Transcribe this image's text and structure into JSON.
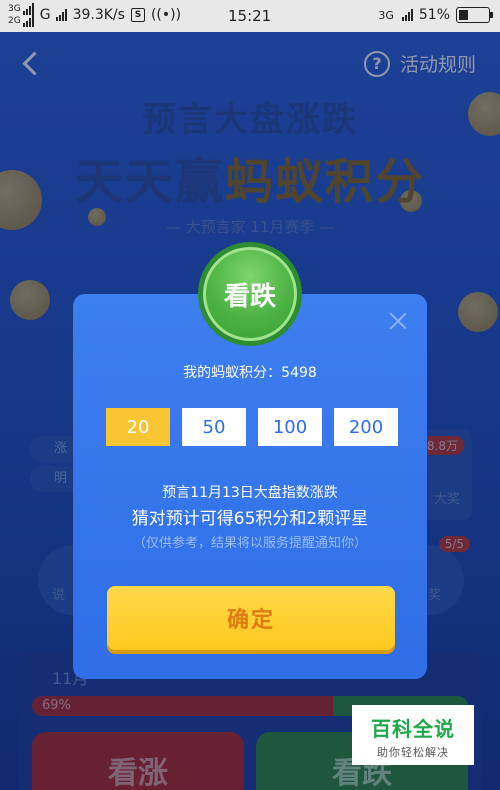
{
  "status_bar": {
    "net_top": "3G",
    "net_bottom": "2G",
    "carrier": "G",
    "speed": "39.3K/s",
    "time": "15:21",
    "net_right": "3G",
    "battery": "51%"
  },
  "navbar": {
    "rules_label": "活动规则"
  },
  "hero": {
    "line1": "预言大盘涨跌",
    "line2_prefix": "天天赢",
    "line2_highlight": "蚂蚁积分",
    "season": "— 大预言家 11月赛季 —"
  },
  "background": {
    "pill1": "涨",
    "pill2": "明",
    "right_badge": "38.8万",
    "right_text": "大奖",
    "badge_count": "5/5",
    "circle_left": "说",
    "circle_right": "奖",
    "bottom_left_text": "11月",
    "progress_percent": 69,
    "progress_label": "69%",
    "btn_rise": "看涨",
    "btn_fall": "看跌"
  },
  "modal": {
    "badge": "看跌",
    "points_text": "我的蚂蚁积分：5498",
    "options": [
      "20",
      "50",
      "100",
      "200"
    ],
    "selected_option": "20",
    "prediction_line1": "预言11月13日大盘指数涨跌",
    "prediction_line2": "猜对预计可得65积分和2颗评星",
    "prediction_note": "（仅供参考，结果将以服务提醒通知你）",
    "confirm_label": "确定"
  },
  "watermark": {
    "title": "百科全说",
    "subtitle": "助你轻松解决"
  },
  "colors": {
    "modal_bg": "#3d7ef0",
    "selected_option": "#f7c531",
    "confirm_bg": "#ffc91f",
    "confirm_text": "#e07a13",
    "badge_green": "#4cb243"
  }
}
